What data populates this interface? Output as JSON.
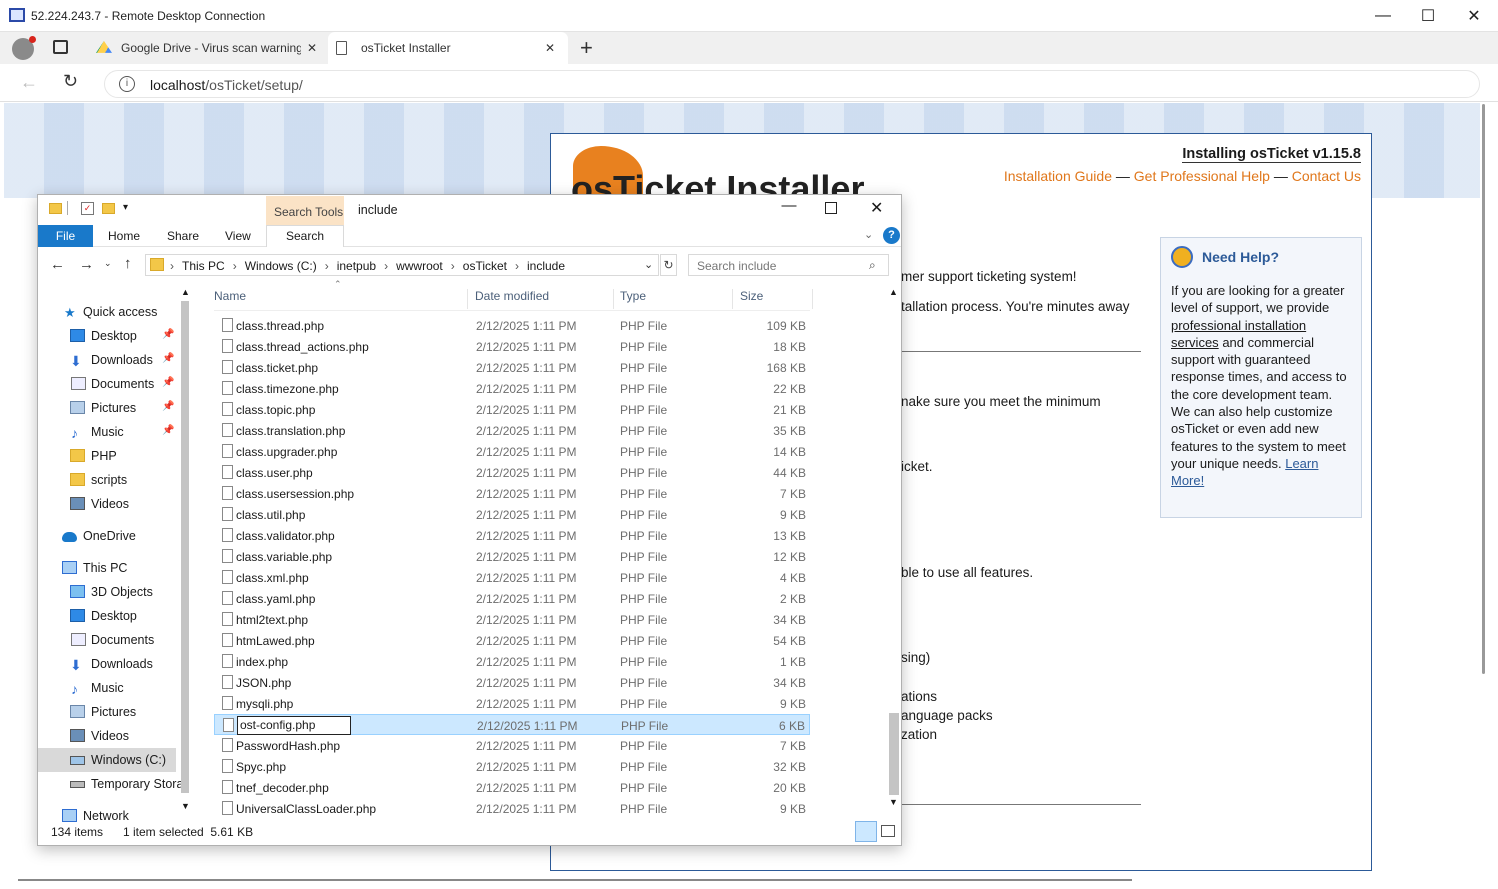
{
  "rdp": {
    "title": "52.224.243.7 - Remote Desktop Connection"
  },
  "browser": {
    "tabs": [
      {
        "label": "Google Drive - Virus scan warning"
      },
      {
        "label": "osTicket Installer"
      }
    ],
    "url_host": "localhost",
    "url_path": "/osTicket/setup/"
  },
  "installer": {
    "logo_text": "osTicket Installer",
    "heading": "Installing osTicket v1.15.8",
    "links": [
      "Installation Guide",
      "Get Professional Help",
      "Contact Us"
    ],
    "sep": "—",
    "body_fragments": [
      "mer support ticketing system!",
      "tallation process. You're minutes away",
      "nake sure you meet the minimum",
      "icket.",
      "ble to use all features.",
      "sing)",
      "ations",
      "anguage packs",
      "zation"
    ],
    "help": {
      "title": "Need Help?",
      "p1": "If you are looking for a greater level of support, we provide",
      "link1": "professional installation services",
      "p2": "and commercial support with guaranteed response times, and access to the core development team. We can also help customize osTicket or even add new features to the system to meet your unique needs.",
      "link2": "Learn More!"
    }
  },
  "explorer": {
    "title": "include",
    "context_tab": "Search Tools",
    "ribbon_tabs": [
      "File",
      "Home",
      "Share",
      "View",
      "Search"
    ],
    "breadcrumb": [
      "This PC",
      "Windows (C:)",
      "inetpub",
      "wwwroot",
      "osTicket",
      "include"
    ],
    "search_placeholder": "Search include",
    "columns": {
      "name": "Name",
      "date": "Date modified",
      "type": "Type",
      "size": "Size"
    },
    "files": [
      {
        "name": "class.thread.php",
        "date": "2/12/2025 1:11 PM",
        "type": "PHP File",
        "size": "109 KB"
      },
      {
        "name": "class.thread_actions.php",
        "date": "2/12/2025 1:11 PM",
        "type": "PHP File",
        "size": "18 KB"
      },
      {
        "name": "class.ticket.php",
        "date": "2/12/2025 1:11 PM",
        "type": "PHP File",
        "size": "168 KB"
      },
      {
        "name": "class.timezone.php",
        "date": "2/12/2025 1:11 PM",
        "type": "PHP File",
        "size": "22 KB"
      },
      {
        "name": "class.topic.php",
        "date": "2/12/2025 1:11 PM",
        "type": "PHP File",
        "size": "21 KB"
      },
      {
        "name": "class.translation.php",
        "date": "2/12/2025 1:11 PM",
        "type": "PHP File",
        "size": "35 KB"
      },
      {
        "name": "class.upgrader.php",
        "date": "2/12/2025 1:11 PM",
        "type": "PHP File",
        "size": "14 KB"
      },
      {
        "name": "class.user.php",
        "date": "2/12/2025 1:11 PM",
        "type": "PHP File",
        "size": "44 KB"
      },
      {
        "name": "class.usersession.php",
        "date": "2/12/2025 1:11 PM",
        "type": "PHP File",
        "size": "7 KB"
      },
      {
        "name": "class.util.php",
        "date": "2/12/2025 1:11 PM",
        "type": "PHP File",
        "size": "9 KB"
      },
      {
        "name": "class.validator.php",
        "date": "2/12/2025 1:11 PM",
        "type": "PHP File",
        "size": "13 KB"
      },
      {
        "name": "class.variable.php",
        "date": "2/12/2025 1:11 PM",
        "type": "PHP File",
        "size": "12 KB"
      },
      {
        "name": "class.xml.php",
        "date": "2/12/2025 1:11 PM",
        "type": "PHP File",
        "size": "4 KB"
      },
      {
        "name": "class.yaml.php",
        "date": "2/12/2025 1:11 PM",
        "type": "PHP File",
        "size": "2 KB"
      },
      {
        "name": "html2text.php",
        "date": "2/12/2025 1:11 PM",
        "type": "PHP File",
        "size": "34 KB"
      },
      {
        "name": "htmLawed.php",
        "date": "2/12/2025 1:11 PM",
        "type": "PHP File",
        "size": "54 KB"
      },
      {
        "name": "index.php",
        "date": "2/12/2025 1:11 PM",
        "type": "PHP File",
        "size": "1 KB"
      },
      {
        "name": "JSON.php",
        "date": "2/12/2025 1:11 PM",
        "type": "PHP File",
        "size": "34 KB"
      },
      {
        "name": "mysqli.php",
        "date": "2/12/2025 1:11 PM",
        "type": "PHP File",
        "size": "9 KB"
      },
      {
        "name": "ost-config.php",
        "date": "2/12/2025 1:11 PM",
        "type": "PHP File",
        "size": "6 KB"
      },
      {
        "name": "PasswordHash.php",
        "date": "2/12/2025 1:11 PM",
        "type": "PHP File",
        "size": "7 KB"
      },
      {
        "name": "Spyc.php",
        "date": "2/12/2025 1:11 PM",
        "type": "PHP File",
        "size": "32 KB"
      },
      {
        "name": "tnef_decoder.php",
        "date": "2/12/2025 1:11 PM",
        "type": "PHP File",
        "size": "20 KB"
      },
      {
        "name": "UniversalClassLoader.php",
        "date": "2/12/2025 1:11 PM",
        "type": "PHP File",
        "size": "9 KB"
      }
    ],
    "nav": [
      {
        "label": "Quick access",
        "icon": "star-icon"
      },
      {
        "label": "Desktop",
        "icon": "desktop-icon"
      },
      {
        "label": "Downloads",
        "icon": "download-icon"
      },
      {
        "label": "Documents",
        "icon": "documents-icon"
      },
      {
        "label": "Pictures",
        "icon": "pictures-icon"
      },
      {
        "label": "Music",
        "icon": "music-icon"
      },
      {
        "label": "PHP",
        "icon": "folder-icon"
      },
      {
        "label": "scripts",
        "icon": "folder-icon"
      },
      {
        "label": "Videos",
        "icon": "videos-icon"
      },
      {
        "label": "OneDrive",
        "icon": "cloud-icon"
      },
      {
        "label": "This PC",
        "icon": "pc-icon"
      },
      {
        "label": "3D Objects",
        "icon": "cube-icon"
      },
      {
        "label": "Desktop",
        "icon": "desktop-icon"
      },
      {
        "label": "Documents",
        "icon": "documents-icon"
      },
      {
        "label": "Downloads",
        "icon": "download-icon"
      },
      {
        "label": "Music",
        "icon": "music-icon"
      },
      {
        "label": "Pictures",
        "icon": "pictures-icon"
      },
      {
        "label": "Videos",
        "icon": "videos-icon"
      },
      {
        "label": "Windows (C:)",
        "icon": "drive-icon"
      },
      {
        "label": "Temporary Stora",
        "icon": "drive-icon"
      },
      {
        "label": "Network",
        "icon": "network-icon"
      }
    ],
    "status": {
      "count": "134 items",
      "selected": "1 item selected  5.61 KB"
    },
    "colors": {
      "accent": "#1979ca",
      "selection": "#cce8ff",
      "file_tab": "#1979ca"
    }
  }
}
